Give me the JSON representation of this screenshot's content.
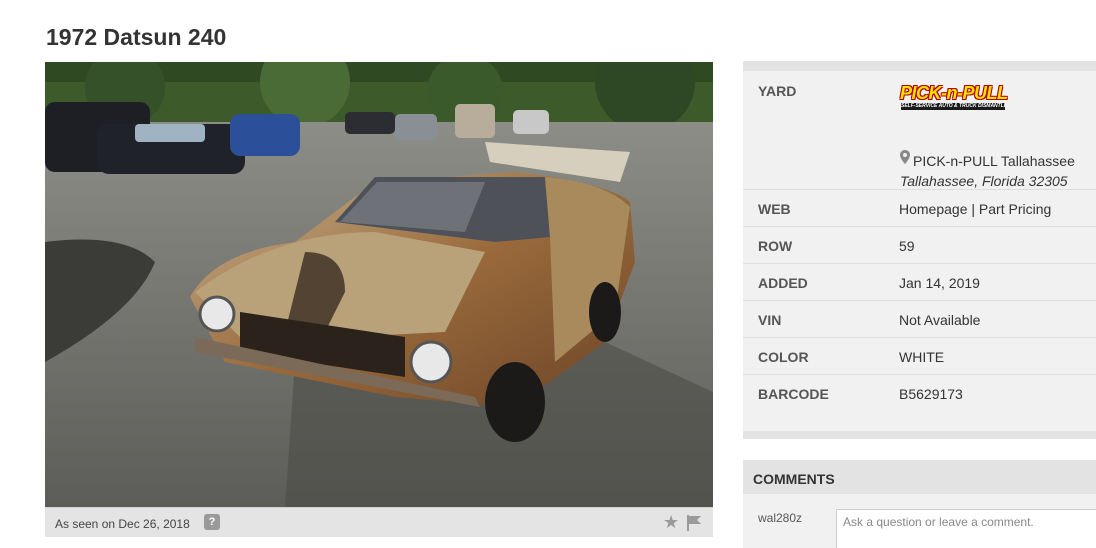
{
  "page": {
    "title": "1972 Datsun 240"
  },
  "photo": {
    "caption": "As seen on Dec 26, 2018",
    "help_glyph": "?",
    "star_glyph": "★",
    "icons": [
      "help-icon",
      "star-icon",
      "flag-icon"
    ]
  },
  "yard": {
    "label": "YARD",
    "logo_text": "PICK-n-PULL",
    "logo_tagline": "SELF-SERVICE AUTO & TRUCK DISMANTLERS",
    "name": "PICK-n-PULL Tallahassee",
    "city": "Tallahassee, Florida 32305"
  },
  "details": {
    "web_label": "WEB",
    "web_homepage": "Homepage",
    "web_separator": "|",
    "web_part_pricing": "Part Pricing",
    "row_label": "ROW",
    "row_value": "59",
    "added_label": "ADDED",
    "added_value": "Jan 14, 2019",
    "vin_label": "VIN",
    "vin_value": "Not Available",
    "color_label": "COLOR",
    "color_value": "WHITE",
    "barcode_label": "BARCODE",
    "barcode_value": "B5629173"
  },
  "comments": {
    "title": "COMMENTS",
    "user": "wal280z",
    "placeholder": "Ask a question or leave a comment."
  },
  "colors": {
    "panel_bg": "#f1f1f1",
    "panel_border": "#e3e3e3",
    "logo_yellow": "#ffe000",
    "logo_red": "#b40000"
  }
}
